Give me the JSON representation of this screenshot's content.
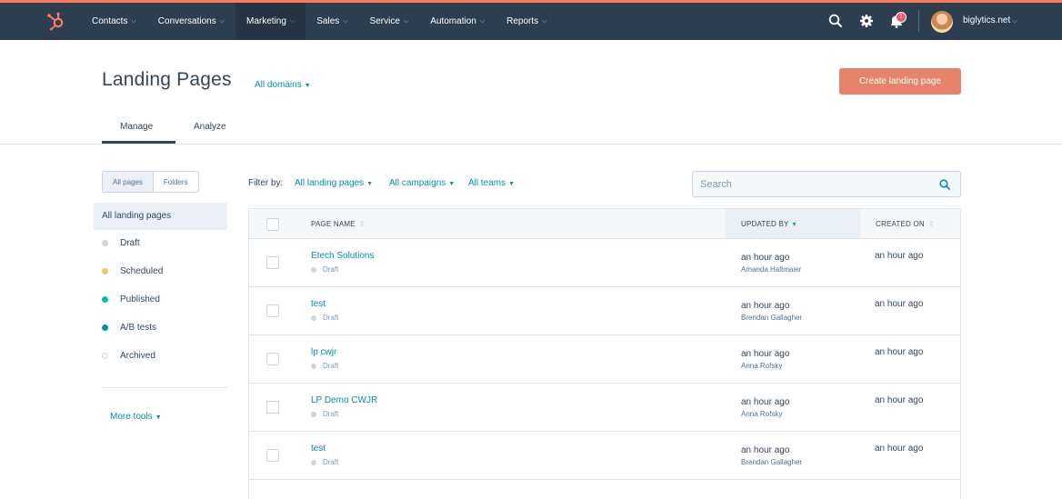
{
  "nav": {
    "items": [
      {
        "label": "Contacts"
      },
      {
        "label": "Conversations"
      },
      {
        "label": "Marketing",
        "active": true
      },
      {
        "label": "Sales"
      },
      {
        "label": "Service"
      },
      {
        "label": "Automation"
      },
      {
        "label": "Reports"
      }
    ],
    "notification_count": "1",
    "account": "biglytics.net",
    "icons": [
      "hubspot-logo-icon",
      "search-icon",
      "gear-icon",
      "bell-icon"
    ],
    "colors": {
      "bar": "#2d3e50",
      "accent": "#ff7a59"
    }
  },
  "header": {
    "title": "Landing Pages",
    "domains": "All domains",
    "create_button": "Create landing page"
  },
  "tabs": {
    "manage": "Manage",
    "analyze": "Analyze"
  },
  "sidebar": {
    "toggle": {
      "all_pages": "All pages",
      "folders": "Folders"
    },
    "all_label": "All landing pages",
    "statuses": [
      {
        "label": "Draft",
        "color": "#cbd6e2"
      },
      {
        "label": "Scheduled",
        "color": "#f5c26b"
      },
      {
        "label": "Published",
        "color": "#00bda5"
      },
      {
        "label": "A/B tests",
        "color": "#0091ae"
      },
      {
        "label": "Archived",
        "color": "#ffffff"
      }
    ],
    "more_tools": "More tools"
  },
  "filters": {
    "label": "Filter by:",
    "pages": "All landing pages",
    "campaigns": "All campaigns",
    "teams": "All teams"
  },
  "search": {
    "placeholder": "Search"
  },
  "table": {
    "columns": {
      "name": "PAGE NAME",
      "updated": "UPDATED BY",
      "created": "CREATED ON"
    },
    "rows": [
      {
        "name": "Etech Solutions",
        "status": "Draft",
        "updated": "an hour ago",
        "updated_by": "Amanda Haltmaier",
        "created": "an hour ago"
      },
      {
        "name": "test",
        "status": "Draft",
        "updated": "an hour ago",
        "updated_by": "Brendan Gallagher",
        "created": "an hour ago"
      },
      {
        "name": "lp cwjr",
        "status": "Draft",
        "updated": "an hour ago",
        "updated_by": "Anna Rofsky",
        "created": "an hour ago"
      },
      {
        "name": "LP Demo CWJR",
        "status": "Draft",
        "updated": "an hour ago",
        "updated_by": "Anna Rofsky",
        "created": "an hour ago"
      },
      {
        "name": "test",
        "status": "Draft",
        "updated": "an hour ago",
        "updated_by": "Brendan Gallagher",
        "created": "an hour ago"
      }
    ]
  }
}
